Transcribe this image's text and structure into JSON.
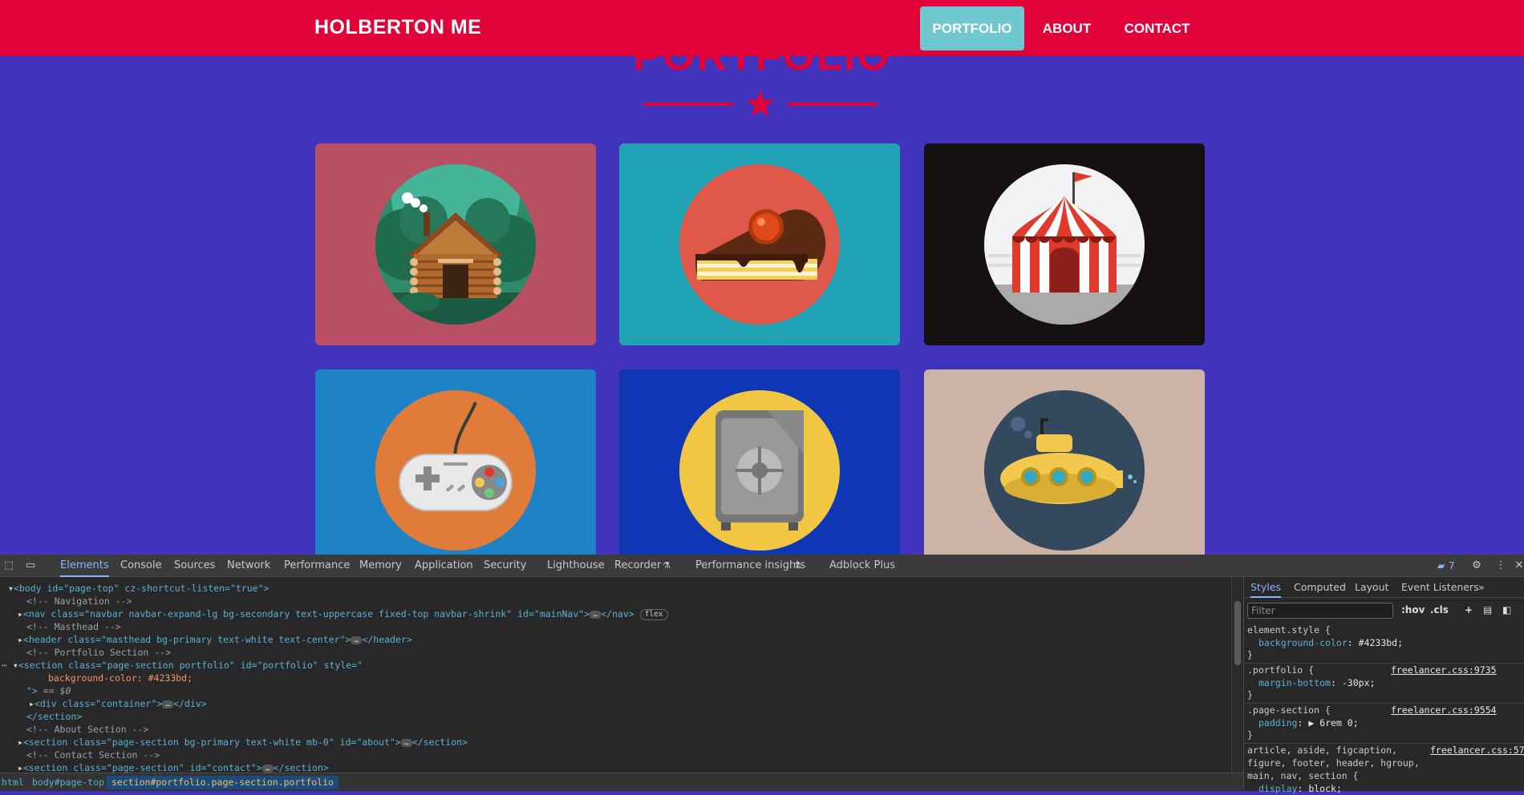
{
  "navbar": {
    "brand": "HOLBERTON ME",
    "items": [
      {
        "label": "PORTFOLIO",
        "active": true
      },
      {
        "label": "ABOUT",
        "active": false
      },
      {
        "label": "CONTACT",
        "active": false
      }
    ]
  },
  "portfolio": {
    "heading": "PORTFOLIO",
    "items": [
      {
        "name": "cabin",
        "bg": "#b94f63"
      },
      {
        "name": "cake",
        "bg": "#20a3b5"
      },
      {
        "name": "circus",
        "bg": "#141110"
      },
      {
        "name": "game-controller",
        "bg": "#1e83c6"
      },
      {
        "name": "safe",
        "bg": "#0f37b5"
      },
      {
        "name": "submarine",
        "bg": "#cdb3a5"
      }
    ]
  },
  "colors": {
    "primary_bg": "#4233bd",
    "nav_red": "#e2023a",
    "nav_active": "#6fc7d0"
  },
  "devtools": {
    "tabs": [
      "Elements",
      "Console",
      "Sources",
      "Network",
      "Performance",
      "Memory",
      "Application",
      "Security",
      "Lighthouse",
      "Recorder",
      "Performance insights",
      "Adblock Plus"
    ],
    "active_tab": "Elements",
    "issues_count": "7",
    "dom": {
      "body_open": "<body id=\"page-top\" cz-shortcut-listen=\"true\">",
      "comment_nav": "<!-- Navigation -->",
      "nav_line": "<nav class=\"navbar navbar-expand-lg bg-secondary text-uppercase fixed-top navbar-shrink\" id=\"mainNav\">",
      "nav_close": "</nav>",
      "flex_badge": "flex",
      "comment_masthead": "<!-- Masthead -->",
      "header_line": "<header class=\"masthead bg-primary text-white text-center\">",
      "header_close": "</header>",
      "comment_portfolio": "<!-- Portfolio Section -->",
      "section_open": "<section class=\"page-section portfolio\" id=\"portfolio\" style=\"",
      "section_style": "background-color: #4233bd;",
      "section_end": "\">",
      "selected_marker": "== $0",
      "div_line": "<div class=\"container\">",
      "div_close": "</div>",
      "section_close": "</section>",
      "comment_about": "<!-- About Section -->",
      "about_line": "<section class=\"page-section bg-primary text-white mb-0\" id=\"about\">",
      "about_close": "</section>",
      "comment_contact": "<!-- Contact Section -->",
      "contact_line": "<section class=\"page-section\" id=\"contact\">",
      "contact_close": "</section>"
    },
    "breadcrumbs": [
      "html",
      "body#page-top",
      "section#portfolio.page-section.portfolio"
    ],
    "styles": {
      "tabs": [
        "Styles",
        "Computed",
        "Layout",
        "Event Listeners"
      ],
      "filter_placeholder": "Filter",
      "hov": ":hov",
      "cls": ".cls",
      "rules": [
        {
          "selector": "element.style {",
          "source": "",
          "decls": [
            [
              "background-color",
              "#4233bd;"
            ]
          ]
        },
        {
          "selector": ".portfolio {",
          "source": "freelancer.css:9735",
          "decls": [
            [
              "margin-bottom",
              "-30px;"
            ]
          ]
        },
        {
          "selector": ".page-section {",
          "source": "freelancer.css:9554",
          "decls": [
            [
              "padding",
              "▶ 6rem 0;"
            ]
          ]
        },
        {
          "selector": "article, aside, figcaption,",
          "selector2": "figure, footer, header, hgroup,",
          "selector3": "main, nav, section {",
          "source": "freelancer.css:57",
          "decls": [
            [
              "display",
              "block;"
            ]
          ]
        }
      ]
    }
  }
}
